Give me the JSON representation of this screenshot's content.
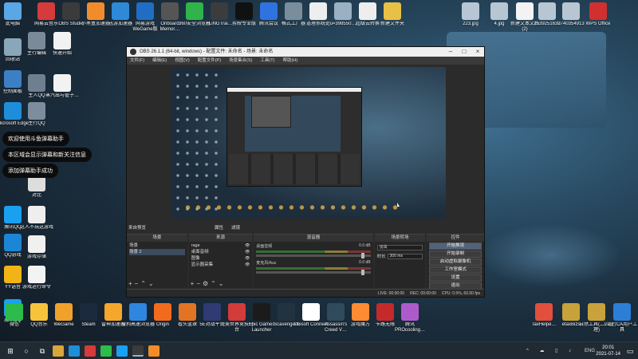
{
  "desktop": {
    "left_col": [
      {
        "label": "此电脑",
        "icon": "computer-icon",
        "color": "#5aa7e6"
      },
      {
        "label": "回收站",
        "icon": "recycle-bin-icon",
        "color": "#8aa6b9"
      },
      {
        "label": "控制面板",
        "icon": "control-panel-icon",
        "color": "#3d7fc4"
      },
      {
        "label": "Microsoft Edge",
        "icon": "edge-icon",
        "color": "#1f8ed8"
      },
      {
        "label": "腾讯QQ",
        "icon": "qq-icon",
        "color": "#1aa0f0"
      },
      {
        "label": "QQ游戏",
        "icon": "qq-game-icon",
        "color": "#1d86d4"
      },
      {
        "label": "YY语音",
        "icon": "yy-icon",
        "color": "#f2b316"
      },
      {
        "label": "腾讯QQ",
        "icon": "qq-icon",
        "color": "#1aa0f0"
      }
    ],
    "second_col": [
      {
        "label": "主行编辑",
        "icon": "person-icon",
        "color": "#7b8a99"
      },
      {
        "label": "主人QQ",
        "icon": "person-icon",
        "color": "#6f7f8f"
      },
      {
        "label": "主行QQ",
        "icon": "person-icon",
        "color": "#7d8d9d"
      },
      {
        "label": "对比",
        "icon": "document-icon",
        "color": "#dddddd"
      },
      {
        "label": "这人不玩这游戏",
        "icon": "document-icon",
        "color": "#eeeeee"
      },
      {
        "label": "游戏存储",
        "icon": "document-icon",
        "color": "#f0f0f0"
      },
      {
        "label": "游戏运行命令",
        "icon": "document-icon",
        "color": "#f3f3f3"
      }
    ],
    "third_col": [
      {
        "label": "快速开始",
        "icon": "document-icon",
        "color": "#f2f2f2"
      },
      {
        "label": "蒸汽出与管子…",
        "icon": "document-icon",
        "color": "#f2f2f2"
      }
    ],
    "top_row": [
      {
        "label": "网易云音乐",
        "icon": "netease-music-icon",
        "color": "#d63b3b"
      },
      {
        "label": "OBS Studio",
        "icon": "obs-icon",
        "color": "#3b3b3b"
      },
      {
        "label": "小黑盒加速器",
        "icon": "xiaoheihe-icon",
        "color": "#f28c2b"
      },
      {
        "label": "迅游加速器",
        "icon": "xunyou-icon",
        "color": "#2e8ad6"
      },
      {
        "label": "网易游戏 WeGame版",
        "icon": "wegame-icon",
        "color": "#1f6ec3"
      },
      {
        "label": "Onboard Memor…",
        "icon": "memory-icon",
        "color": "#555555"
      },
      {
        "label": "360安全浏览器",
        "icon": "browser-360-icon",
        "color": "#2fb34a"
      },
      {
        "label": "FLiNGTrai…",
        "icon": "trainer-icon",
        "color": "#3c3c3c"
      },
      {
        "label": "剪映专业版",
        "icon": "capcut-icon",
        "color": "#111111"
      },
      {
        "label": "腾讯会议",
        "icon": "meeting-icon",
        "color": "#2f73e0"
      },
      {
        "label": "格式工厂器",
        "icon": "format-factory-icon",
        "color": "#7a8d9c"
      },
      {
        "label": "道理系统处",
        "icon": "document-icon",
        "color": "#eeeeee"
      },
      {
        "label": "u=398550…",
        "icon": "image-icon",
        "color": "#9ab0c3"
      },
      {
        "label": "超级云转换",
        "icon": "document-icon",
        "color": "#eeeeee"
      },
      {
        "label": "新建文件夹",
        "icon": "folder-icon",
        "color": "#e9c046"
      }
    ],
    "top_right": [
      {
        "label": "223.jpg",
        "icon": "image-icon",
        "color": "#b8c6d3"
      },
      {
        "label": "4.jpg",
        "icon": "image-icon",
        "color": "#b8c6d3"
      },
      {
        "label": "新建文本文档 (2)",
        "icon": "document-icon",
        "color": "#f3f3f3"
      },
      {
        "label": "2539251630",
        "icon": "image-icon",
        "color": "#b8c6d3"
      },
      {
        "label": "2740354913",
        "icon": "image-icon",
        "color": "#b8c6d3"
      },
      {
        "label": "WPS Office",
        "icon": "wps-icon",
        "color": "#d0302f"
      }
    ],
    "bottom_row": [
      {
        "label": "微信",
        "icon": "wechat-icon",
        "color": "#2dbb4c"
      },
      {
        "label": "QQ音乐",
        "icon": "qq-music-icon",
        "color": "#f6c33b"
      },
      {
        "label": "WeGame",
        "icon": "wegame-icon",
        "color": "#f0a12b"
      },
      {
        "label": "Steam",
        "icon": "steam-icon",
        "color": "#1b2a3d"
      },
      {
        "label": "雷神加速器",
        "icon": "leishen-icon",
        "color": "#f5a62b"
      },
      {
        "label": "搜狗高速浏览器",
        "icon": "sogou-icon",
        "color": "#2f86e0"
      },
      {
        "label": "Origin",
        "icon": "origin-icon",
        "color": "#f26b1d"
      },
      {
        "label": "看头篮球",
        "icon": "basketball-icon",
        "color": "#e37424"
      },
      {
        "label": "5E对战平台",
        "icon": "fivee-icon",
        "color": "#303a73"
      },
      {
        "label": "完美世界竞技平台",
        "icon": "perfect-world-icon",
        "color": "#d43b3b"
      },
      {
        "label": "Epic Games Launcher",
        "icon": "epic-icon",
        "color": "#1b1b1b"
      },
      {
        "label": "Scavengers",
        "icon": "scavengers-icon",
        "color": "#22333f"
      },
      {
        "label": "Ubisoft Connect",
        "icon": "ubisoft-icon",
        "color": "#ffffff"
      },
      {
        "label": "Assassin's Creed V…",
        "icon": "assassins-creed-icon",
        "color": "#2f4a5a"
      },
      {
        "label": "游戏魔方",
        "icon": "game-cube-icon",
        "color": "#ff8c32"
      },
      {
        "label": "卡路无限",
        "icon": "game-icon",
        "color": "#c42a2a"
      },
      {
        "label": "腾讯 PROcooling…",
        "icon": "pro-icon",
        "color": "#ad5bcb"
      }
    ],
    "bottom_right": [
      {
        "label": "TaxHelpe…",
        "icon": "tax-helper-icon",
        "color": "#e24f3c"
      },
      {
        "label": "etaxBizs",
        "icon": "archive-icon",
        "color": "#c8a23b"
      },
      {
        "label": "自然工具(二四整理)",
        "icon": "archive-icon",
        "color": "#c8a23b"
      },
      {
        "label": "工行CA用户工具",
        "icon": "icbc-icon",
        "color": "#2c7fd6"
      }
    ]
  },
  "notifications": [
    "欢迎使用斗鱼弹幕助手",
    "本区域会显示弹幕和新关注信息",
    "添加弹幕助手成功"
  ],
  "obs": {
    "title": "OBS 26.1.1 (64-bit, windows) - 配置文件: 未命名 - 场景: 未命名",
    "menu": [
      "文件(F)",
      "编辑(E)",
      "视图(V)",
      "配置文件(P)",
      "场景集合(S)",
      "工具(T)",
      "帮助(H)"
    ],
    "preview_label": "来自预览",
    "toolbar": [
      "属性",
      "滤镜"
    ],
    "scenes": {
      "header": "场景",
      "items": [
        "场景",
        "场景 2"
      ]
    },
    "sources": {
      "header": "来源",
      "items": [
        "rage",
        "桌面音频",
        "图像",
        "显示器采集"
      ]
    },
    "mixer": {
      "header": "混音器",
      "tracks": [
        {
          "name": "桌面音频",
          "db": "0.0 dB"
        },
        {
          "name": "麦克风/Aux",
          "db": "0.0 dB"
        }
      ]
    },
    "transitions": {
      "header": "场景转场",
      "type": "淡出",
      "duration_label": "时长",
      "duration": "300 ms"
    },
    "controls": {
      "header": "控件",
      "buttons": [
        "开始推流",
        "开始录制",
        "启动虚拟摄像机",
        "工作室模式",
        "设置",
        "退出"
      ]
    },
    "status": [
      "LIVE: 00:00:00",
      "REC: 00:00:00",
      "CPU: 0.5%, 60.00 fps"
    ]
  },
  "taskbar": {
    "language": "ENG",
    "time": "20:01",
    "date": "2021-07-14",
    "search": "search-icon"
  }
}
